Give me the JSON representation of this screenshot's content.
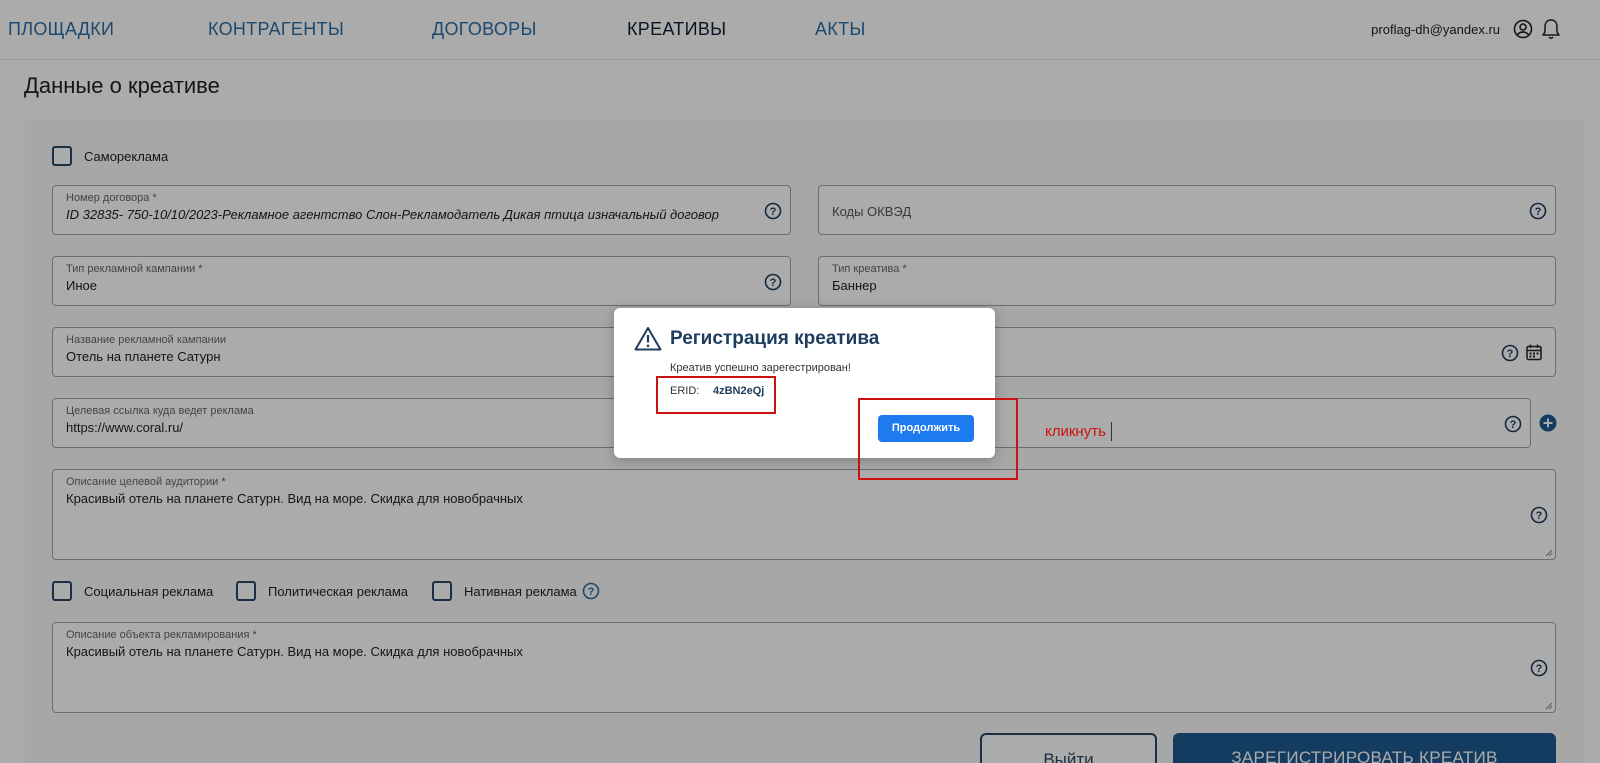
{
  "nav": {
    "items": [
      {
        "label": "ПЛОЩАДКИ"
      },
      {
        "label": "КОНТРАГЕНТЫ"
      },
      {
        "label": "ДОГОВОРЫ"
      },
      {
        "label": "КРЕАТИВЫ"
      },
      {
        "label": "АКТЫ"
      }
    ],
    "active": "КРЕАТИВЫ",
    "user_email": "proflag-dh@yandex.ru",
    "icons": [
      "user-icon",
      "bell-icon"
    ]
  },
  "page": {
    "title": "Данные о креативе"
  },
  "form": {
    "self_ad_label": "Самореклама",
    "contract_number": {
      "label": "Номер договора *",
      "value": "ID 32835- 750-10/10/2023-Рекламное агентство Слон-Рекламодатель Дикая птица изначальный договор"
    },
    "okved": {
      "placeholder": "Коды ОКВЭД"
    },
    "campaign_type": {
      "label": "Тип рекламной кампании *",
      "value": "Иное"
    },
    "creative_type": {
      "label": "Тип креатива *",
      "value": "Баннер"
    },
    "campaign_name": {
      "label": "Название рекламной кампании",
      "value": "Отель на планете Сатурн"
    },
    "target_url": {
      "label": "Целевая ссылка куда ведет реклама",
      "value": "https://www.coral.ru/"
    },
    "audience": {
      "label": "Описание целевой аудитории *",
      "value": "Красивый отель на планете Сатурн. Вид на море. Скидка для новобрачных"
    },
    "ad_flags": {
      "social": "Социальная реклама",
      "political": "Политическая реклама",
      "native": "Нативная реклама"
    },
    "object_description": {
      "label": "Описание объекта рекламирования *",
      "value": "Красивый отель на планете Сатурн. Вид на море. Скидка для новобрачных"
    },
    "exit_label": "Выйти",
    "register_label": "ЗАРЕГИСТРИРОВАТЬ КРЕАТИВ"
  },
  "modal": {
    "title": "Регистрация креатива",
    "message": "Креатив успешно зарегестрирован!",
    "erid_label": "ERID:",
    "erid_value": "4zBN2eQj",
    "continue_label": "Продолжить"
  },
  "annotation": {
    "text": "кликнуть",
    "color": "#cc1111"
  },
  "colors": {
    "nav_link": "#2e6da4",
    "accent_dark": "#1e3d5e",
    "primary_button": "#1d7bef"
  }
}
